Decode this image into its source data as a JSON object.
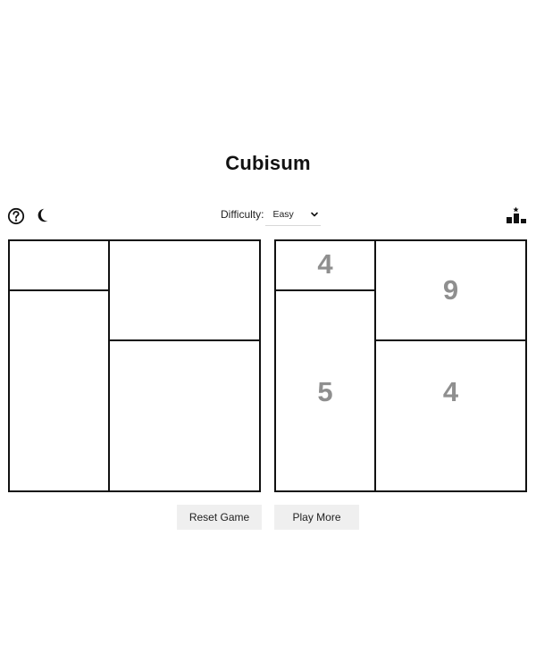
{
  "header": {
    "title": "Cubisum"
  },
  "toolbar": {
    "help_icon": "question-circle-icon",
    "theme_icon": "moon-icon",
    "leaderboard_icon": "podium-icon",
    "difficulty_label": "Difficulty:",
    "difficulty_selected": "Easy"
  },
  "puzzle_board": {
    "regions": [
      "",
      "",
      "",
      ""
    ]
  },
  "solution_board": {
    "regions": [
      "4",
      "5",
      "9",
      "4"
    ]
  },
  "actions": {
    "reset_label": "Reset Game",
    "play_more_label": "Play More"
  },
  "colors": {
    "text": "#111111",
    "grid_line": "#111111",
    "hint_number": "#8f8f8f",
    "button_bg": "#efefef"
  }
}
